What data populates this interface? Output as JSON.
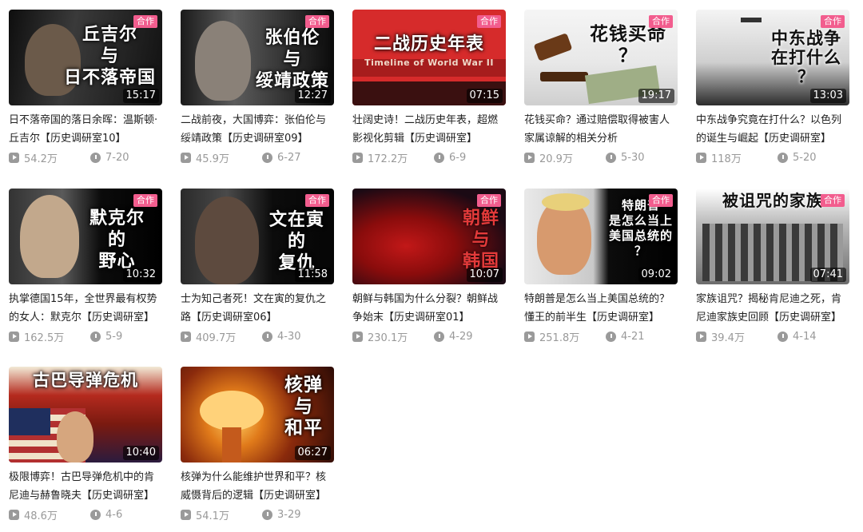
{
  "badge_label": "合作",
  "videos": [
    {
      "thumb_text": "丘吉尔\n与\n日不落帝国",
      "duration": "15:17",
      "title": "日不落帝国的落日余晖：温斯顿·丘吉尔【历史调研室10】",
      "views": "54.2万",
      "date": "7-20"
    },
    {
      "thumb_text": "张伯伦\n与\n绥靖政策",
      "duration": "12:27",
      "title": "二战前夜，大国博弈：张伯伦与绥靖政策【历史调研室09】",
      "views": "45.9万",
      "date": "6-27"
    },
    {
      "thumb_text": "二战历史年表",
      "thumb_sub": "Timeline of World War II",
      "duration": "07:15",
      "title": "壮阔史诗！二战历史年表，超燃影视化剪辑【历史调研室】",
      "views": "172.2万",
      "date": "6-9"
    },
    {
      "thumb_text": "花钱买命\n？",
      "duration": "19:17",
      "title": "花钱买命？通过赔偿取得被害人家属谅解的相关分析",
      "views": "20.9万",
      "date": "5-30"
    },
    {
      "thumb_text": "中东战争\n在打什么\n？",
      "duration": "13:03",
      "title": "中东战争究竟在打什么？以色列的诞生与崛起【历史调研室】",
      "views": "118万",
      "date": "5-20"
    },
    {
      "thumb_text": "默克尔\n的\n野心",
      "duration": "10:32",
      "title": "执掌德国15年，全世界最有权势的女人：默克尔【历史调研室】",
      "views": "162.5万",
      "date": "5-9"
    },
    {
      "thumb_text": "文在寅\n的\n复仇",
      "duration": "11:58",
      "title": "士为知己者死！文在寅的复仇之路【历史调研室06】",
      "views": "409.7万",
      "date": "4-30"
    },
    {
      "thumb_text": "朝鲜\n与\n韩国",
      "duration": "10:07",
      "title": "朝鲜与韩国为什么分裂？朝鲜战争始末【历史调研室01】",
      "views": "230.1万",
      "date": "4-29"
    },
    {
      "thumb_text": "特朗普\n是怎么当上\n美国总统的\n？",
      "duration": "09:02",
      "title": "特朗普是怎么当上美国总统的？懂王的前半生【历史调研室】",
      "views": "251.8万",
      "date": "4-21"
    },
    {
      "thumb_text": "被诅咒的家族",
      "duration": "07:41",
      "title": "家族诅咒？揭秘肯尼迪之死，肯尼迪家族史回顾【历史调研室】",
      "views": "39.4万",
      "date": "4-14"
    },
    {
      "thumb_text": "古巴导弹危机",
      "duration": "10:40",
      "title": "极限博弈！古巴导弹危机中的肯尼迪与赫鲁晓夫【历史调研室】",
      "views": "48.6万",
      "date": "4-6"
    },
    {
      "thumb_text": "核弹\n与\n和平",
      "duration": "06:27",
      "title": "核弹为什么能维护世界和平？核威慑背后的逻辑【历史调研室】",
      "views": "54.1万",
      "date": "3-29"
    }
  ]
}
